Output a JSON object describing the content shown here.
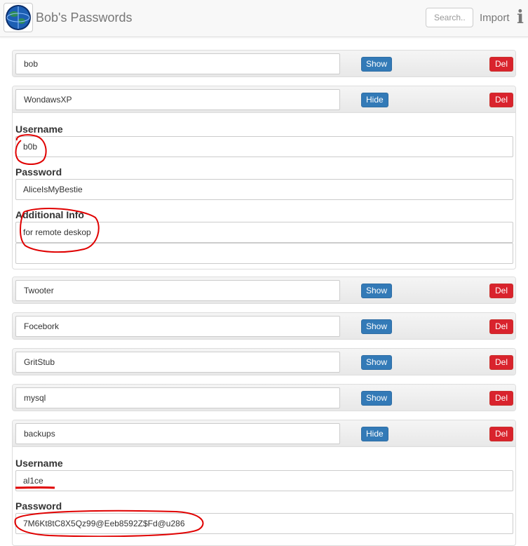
{
  "app": {
    "title": "Bob's Passwords",
    "search_placeholder": "Search..",
    "import_label": "Import",
    "info_glyph": "i",
    "logo_icon": "globe-icon"
  },
  "labels": {
    "username": "Username",
    "password": "Password",
    "additional_info": "Additional Info"
  },
  "entries": [
    {
      "name": "bob",
      "toggle": "Show",
      "delete": "Del"
    },
    {
      "name": "WondawsXP",
      "toggle": "Hide",
      "delete": "Del",
      "username": "b0b",
      "password": "AliceIsMyBestie",
      "info_lines": [
        "for remote deskop",
        ""
      ]
    },
    {
      "name": "Twooter",
      "toggle": "Show",
      "delete": "Del"
    },
    {
      "name": "Focebork",
      "toggle": "Show",
      "delete": "Del"
    },
    {
      "name": "GritStub",
      "toggle": "Show",
      "delete": "Del"
    },
    {
      "name": "mysql",
      "toggle": "Show",
      "delete": "Del"
    },
    {
      "name": "backups",
      "toggle": "Hide",
      "delete": "Del",
      "username": "al1ce",
      "password": "7M6Kt8tC8X5Qz99@Eeb8592Z$Fd@u286"
    }
  ],
  "colors": {
    "primary_button": "#337ab7",
    "danger_button": "#d9232d",
    "annotation": "#e00000"
  }
}
